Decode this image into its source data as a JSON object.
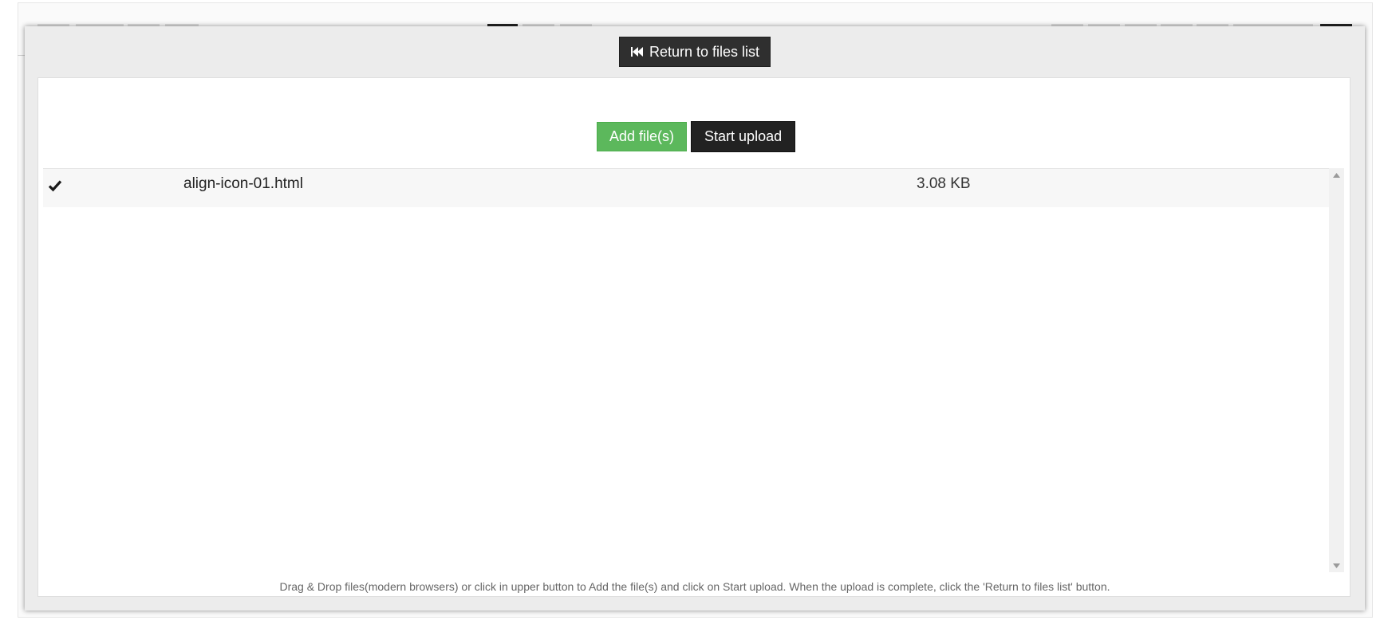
{
  "toolbar": {
    "return_label": "Return to files list",
    "return_icon": "fast-backward-icon"
  },
  "upload": {
    "add_label": "Add file(s)",
    "start_label": "Start upload"
  },
  "files": [
    {
      "status_icon": "check-icon",
      "name": "align-icon-01.html",
      "size": "3.08 KB"
    }
  ],
  "hint": "Drag & Drop files(modern browsers) or click in upper button to Add the file(s) and click on Start upload. When the upload is complete, click the 'Return to files list' button.",
  "colors": {
    "add_button": "#5cb85c",
    "start_button": "#222222",
    "return_button": "#2f2f2f",
    "modal_bg": "#ececec"
  }
}
